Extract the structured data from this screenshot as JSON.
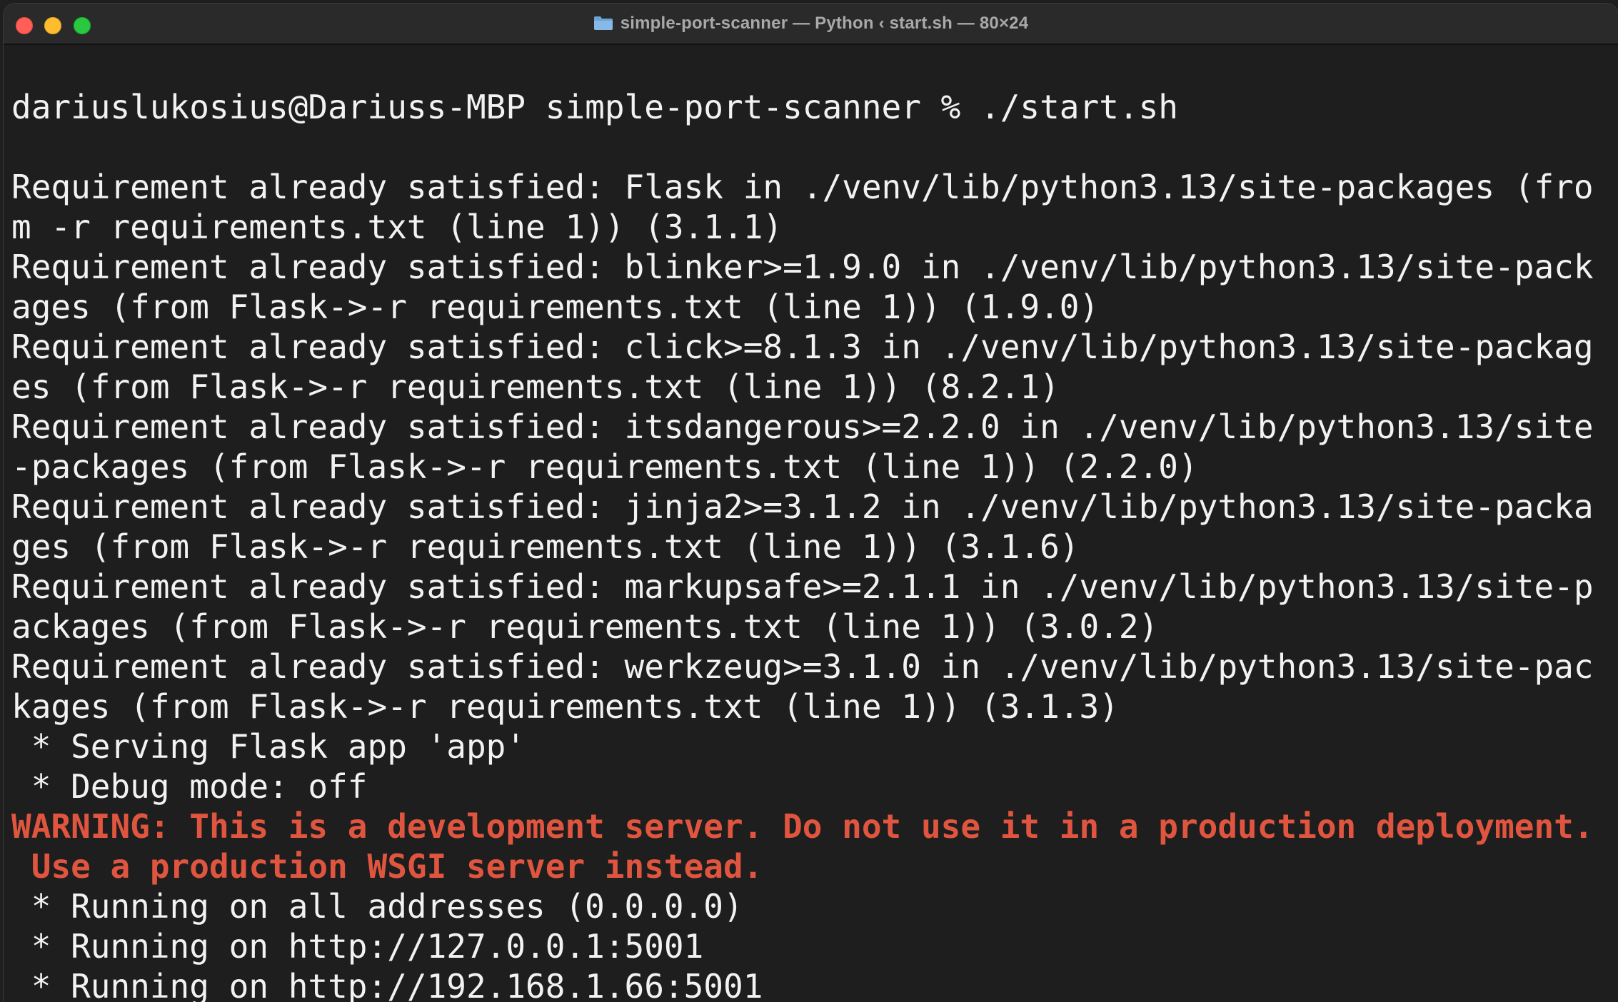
{
  "window": {
    "title": "simple-port-scanner — Python ‹ start.sh — 80×24",
    "folder_icon": "folder-icon",
    "buttons": {
      "close": "close-button",
      "minimize": "minimize-button",
      "maximize": "maximize-button"
    }
  },
  "terminal": {
    "prompt": "dariuslukosius@Dariuss-MBP simple-port-scanner % ./start.sh",
    "lines": [
      "Requirement already satisfied: Flask in ./venv/lib/python3.13/site-packages (fro",
      "m -r requirements.txt (line 1)) (3.1.1)",
      "Requirement already satisfied: blinker>=1.9.0 in ./venv/lib/python3.13/site-pack",
      "ages (from Flask->-r requirements.txt (line 1)) (1.9.0)",
      "Requirement already satisfied: click>=8.1.3 in ./venv/lib/python3.13/site-packag",
      "es (from Flask->-r requirements.txt (line 1)) (8.2.1)",
      "Requirement already satisfied: itsdangerous>=2.2.0 in ./venv/lib/python3.13/site",
      "-packages (from Flask->-r requirements.txt (line 1)) (2.2.0)",
      "Requirement already satisfied: jinja2>=3.1.2 in ./venv/lib/python3.13/site-packa",
      "ges (from Flask->-r requirements.txt (line 1)) (3.1.6)",
      "Requirement already satisfied: markupsafe>=2.1.1 in ./venv/lib/python3.13/site-p",
      "ackages (from Flask->-r requirements.txt (line 1)) (3.0.2)",
      "Requirement already satisfied: werkzeug>=3.1.0 in ./venv/lib/python3.13/site-pac",
      "kages (from Flask->-r requirements.txt (line 1)) (3.1.3)",
      " * Serving Flask app 'app'",
      " * Debug mode: off"
    ],
    "warning_lines": [
      "WARNING: This is a development server. Do not use it in a production deployment.",
      " Use a production WSGI server instead."
    ],
    "final_lines": [
      " * Running on all addresses (0.0.0.0)",
      " * Running on http://127.0.0.1:5001",
      " * Running on http://192.168.1.66:5001"
    ]
  },
  "colors": {
    "background": "#1e1e1e",
    "text": "#f2f2f2",
    "warning": "#e0553f",
    "titlebar": "#2a2a2a"
  }
}
